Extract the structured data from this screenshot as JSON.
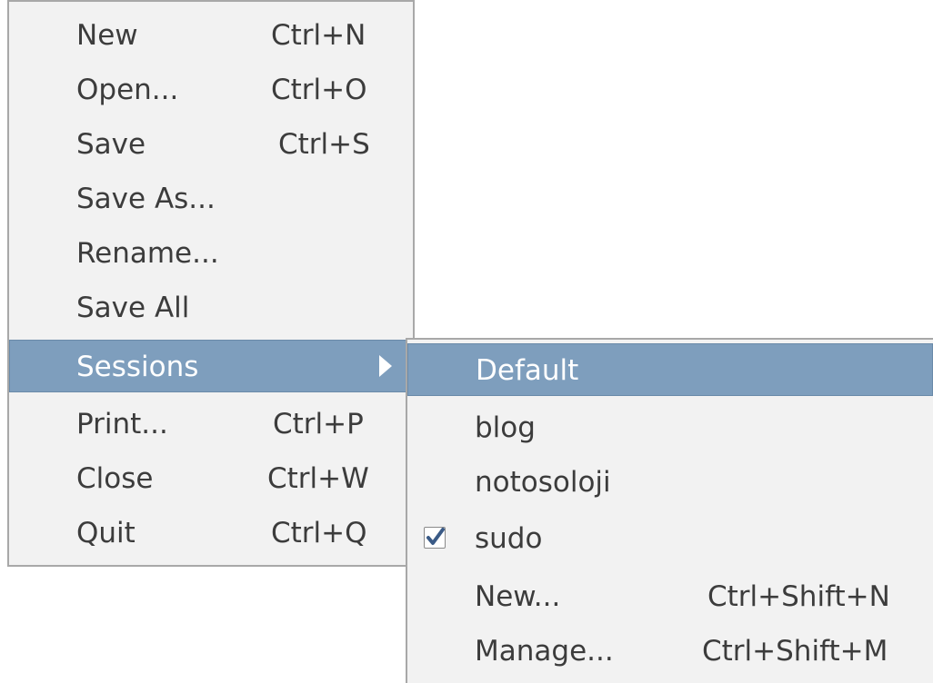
{
  "main_menu": {
    "items": [
      {
        "label": "New",
        "shortcut": "Ctrl+N"
      },
      {
        "label": "Open...",
        "shortcut": "Ctrl+O"
      },
      {
        "label": "Save",
        "shortcut": "Ctrl+S"
      },
      {
        "label": "Save As...",
        "shortcut": ""
      },
      {
        "label": "Rename...",
        "shortcut": ""
      },
      {
        "label": "Save All",
        "shortcut": ""
      },
      {
        "label": "Sessions",
        "shortcut": ""
      },
      {
        "label": "Print...",
        "shortcut": "Ctrl+P"
      },
      {
        "label": "Close",
        "shortcut": "Ctrl+W"
      },
      {
        "label": "Quit",
        "shortcut": "Ctrl+Q"
      }
    ]
  },
  "sessions_menu": {
    "items": [
      {
        "label": "Default",
        "shortcut": ""
      },
      {
        "label": "blog",
        "shortcut": ""
      },
      {
        "label": "notosoloji",
        "shortcut": ""
      },
      {
        "label": "sudo",
        "shortcut": "",
        "checked": true
      },
      {
        "label": "New...",
        "shortcut": "Ctrl+Shift+N"
      },
      {
        "label": "Manage...",
        "shortcut": "Ctrl+Shift+M"
      }
    ]
  },
  "colors": {
    "menu_bg": "#f2f2f2",
    "highlight": "#7e9ebd",
    "text": "#3c3c3c"
  },
  "icons": {
    "submenu_arrow": "triangle-right-icon",
    "check": "check-icon"
  }
}
